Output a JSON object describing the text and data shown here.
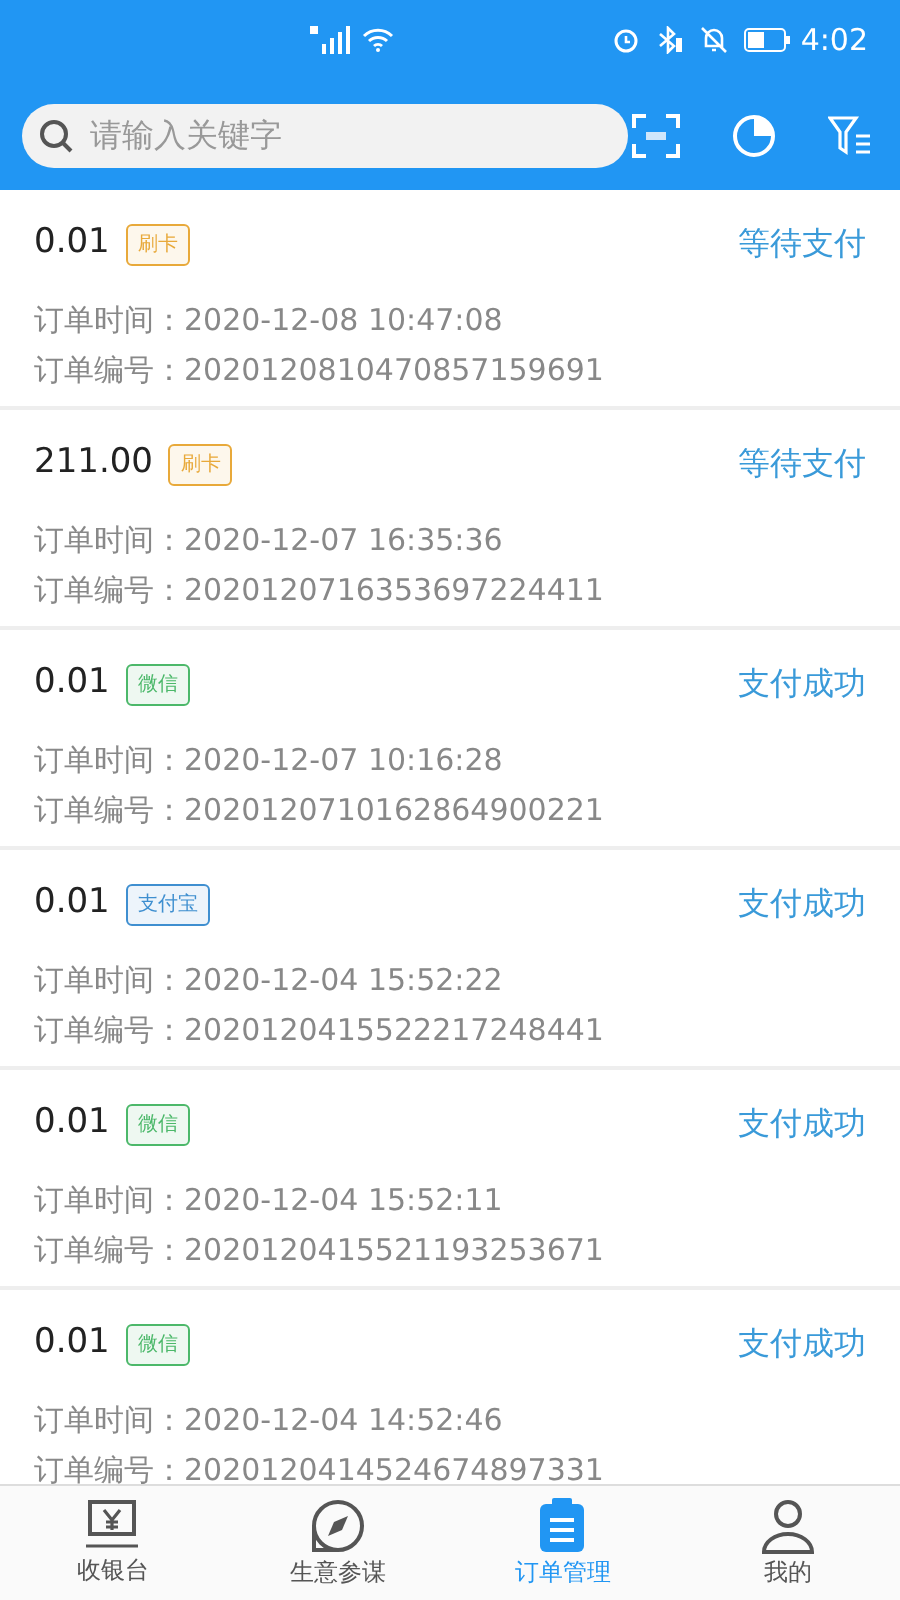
{
  "status_bar": {
    "time": "4:02"
  },
  "search": {
    "placeholder": "请输入关键字"
  },
  "orders": [
    {
      "amount": "0.01",
      "tag": "刷卡",
      "color": "#e8a93a",
      "status": "等待支付",
      "time_label": "订单时间：",
      "time": "2020-12-08 10:47:08",
      "number_label": "订单编号：",
      "number": "2020120810470857159691"
    },
    {
      "amount": "211.00",
      "tag": "刷卡",
      "color": "#e8a93a",
      "status": "等待支付",
      "time_label": "订单时间：",
      "time": "2020-12-07 16:35:36",
      "number_label": "订单编号：",
      "number": "2020120716353697224411"
    },
    {
      "amount": "0.01",
      "tag": "微信",
      "color": "#4cb86a",
      "status": "支付成功",
      "time_label": "订单时间：",
      "time": "2020-12-07 10:16:28",
      "number_label": "订单编号：",
      "number": "2020120710162864900221"
    },
    {
      "amount": "0.01",
      "tag": "支付宝",
      "color": "#3f8fd0",
      "status": "支付成功",
      "time_label": "订单时间：",
      "time": "2020-12-04 15:52:22",
      "number_label": "订单编号：",
      "number": "2020120415522217248441"
    },
    {
      "amount": "0.01",
      "tag": "微信",
      "color": "#4cb86a",
      "status": "支付成功",
      "time_label": "订单时间：",
      "time": "2020-12-04 15:52:11",
      "number_label": "订单编号：",
      "number": "2020120415521193253671"
    },
    {
      "amount": "0.01",
      "tag": "微信",
      "color": "#4cb86a",
      "status": "支付成功",
      "time_label": "订单时间：",
      "time": "2020-12-04 14:52:46",
      "number_label": "订单编号：",
      "number": "2020120414524674897331"
    }
  ],
  "tabs": [
    {
      "label": "收银台",
      "kind": "cashier",
      "selected": false
    },
    {
      "label": "生意参谋",
      "kind": "compass",
      "selected": false
    },
    {
      "label": "订单管理",
      "kind": "orders",
      "selected": true
    },
    {
      "label": "我的",
      "kind": "user",
      "selected": false
    }
  ]
}
